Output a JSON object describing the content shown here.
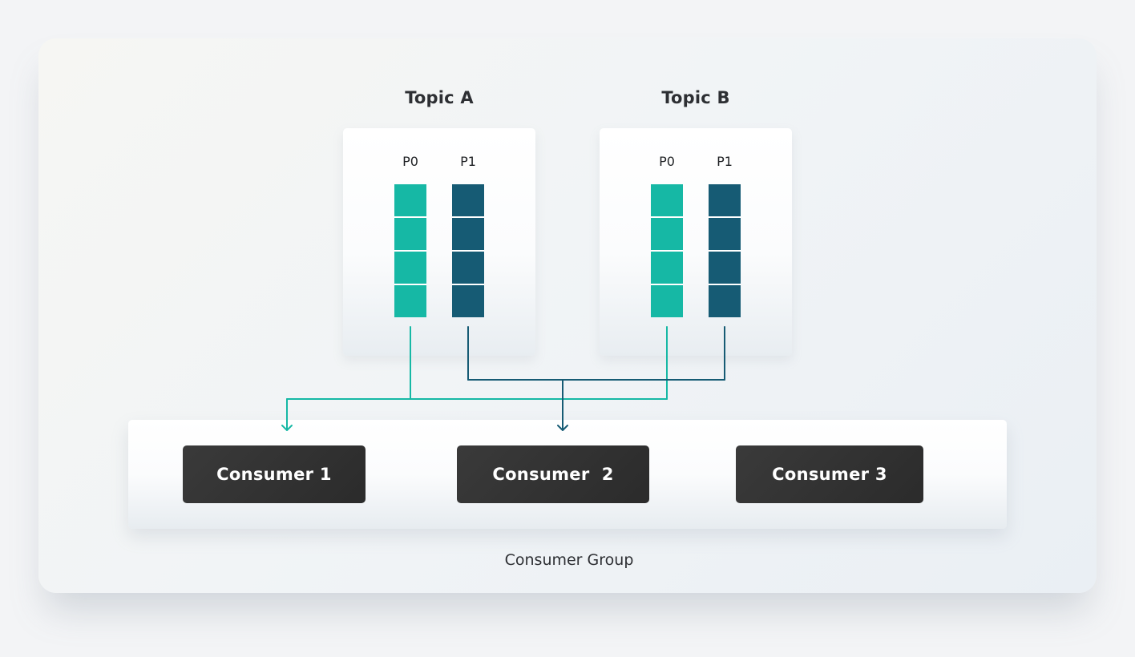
{
  "topics": [
    {
      "title": "Topic A",
      "partitions": [
        {
          "label": "P0",
          "segments": 4
        },
        {
          "label": "P1",
          "segments": 4
        }
      ]
    },
    {
      "title": "Topic B",
      "partitions": [
        {
          "label": "P0",
          "segments": 4
        },
        {
          "label": "P1",
          "segments": 4
        }
      ]
    }
  ],
  "consumers": [
    {
      "label": "Consumer 1"
    },
    {
      "label": "Consumer  2"
    },
    {
      "label": "Consumer 3"
    }
  ],
  "group_label": "Consumer Group",
  "colors": {
    "p0": "#16b8a5",
    "p1": "#165b74",
    "consumer_bg": "#2f2f2f",
    "page_bg": "#f3f4f6"
  },
  "connections": [
    {
      "from": "Topic A P0",
      "to": "Consumer 1"
    },
    {
      "from": "Topic B P0",
      "to": "Consumer 1"
    },
    {
      "from": "Topic A P1",
      "to": "Consumer  2"
    },
    {
      "from": "Topic B P1",
      "to": "Consumer  2"
    }
  ]
}
